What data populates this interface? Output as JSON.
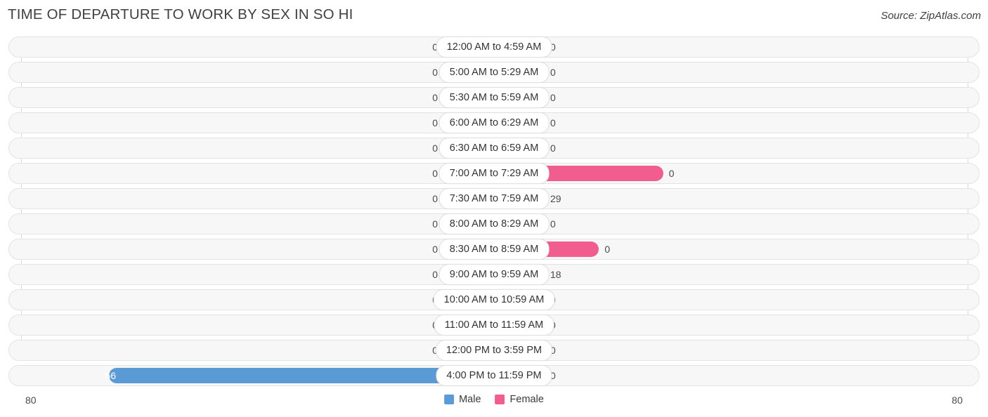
{
  "header": {
    "title": "TIME OF DEPARTURE TO WORK BY SEX IN SO HI",
    "source": "Source: ZipAtlas.com"
  },
  "axis": {
    "left_max_label": "80",
    "right_max_label": "80"
  },
  "legend": {
    "items": [
      {
        "label": "Male",
        "color": "#5b9bd5"
      },
      {
        "label": "Female",
        "color": "#f05d8e"
      }
    ]
  },
  "chart_data": {
    "type": "bar",
    "title": "TIME OF DEPARTURE TO WORK BY SEX IN SO HI",
    "subtitle": "Source: ZipAtlas.com",
    "orientation": "horizontal-diverging",
    "xlabel": "",
    "ylabel": "",
    "xlim": [
      -80,
      80
    ],
    "axis_max": 80,
    "grid": false,
    "legend_position": "bottom-center",
    "categories": [
      "12:00 AM to 4:59 AM",
      "5:00 AM to 5:29 AM",
      "5:30 AM to 5:59 AM",
      "6:00 AM to 6:29 AM",
      "6:30 AM to 6:59 AM",
      "7:00 AM to 7:29 AM",
      "7:30 AM to 7:59 AM",
      "8:00 AM to 8:29 AM",
      "8:30 AM to 8:59 AM",
      "9:00 AM to 9:59 AM",
      "10:00 AM to 10:59 AM",
      "11:00 AM to 11:59 AM",
      "12:00 PM to 3:59 PM",
      "4:00 PM to 11:59 PM"
    ],
    "series": [
      {
        "name": "Male",
        "color": "#5b9bd5",
        "values": [
          0,
          0,
          0,
          0,
          0,
          0,
          0,
          0,
          0,
          0,
          0,
          0,
          0,
          66
        ]
      },
      {
        "name": "Female",
        "color": "#f05d8e",
        "values": [
          0,
          0,
          0,
          0,
          0,
          29,
          0,
          0,
          18,
          0,
          0,
          0,
          0,
          0
        ]
      }
    ]
  },
  "rows": [
    {
      "label": "12:00 AM to 4:59 AM",
      "male": "0",
      "female": "0"
    },
    {
      "label": "5:00 AM to 5:29 AM",
      "male": "0",
      "female": "0"
    },
    {
      "label": "5:30 AM to 5:59 AM",
      "male": "0",
      "female": "0"
    },
    {
      "label": "6:00 AM to 6:29 AM",
      "male": "0",
      "female": "0"
    },
    {
      "label": "6:30 AM to 6:59 AM",
      "male": "0",
      "female": "0"
    },
    {
      "label": "7:00 AM to 7:29 AM",
      "male": "0",
      "female": "0"
    },
    {
      "label": "7:30 AM to 7:59 AM",
      "male": "0",
      "female": "29"
    },
    {
      "label": "8:00 AM to 8:29 AM",
      "male": "0",
      "female": "0"
    },
    {
      "label": "8:30 AM to 8:59 AM",
      "male": "0",
      "female": "0"
    },
    {
      "label": "9:00 AM to 9:59 AM",
      "male": "0",
      "female": "18"
    },
    {
      "label": "10:00 AM to 10:59 AM",
      "male": "0",
      "female": "0"
    },
    {
      "label": "11:00 AM to 11:59 AM",
      "male": "0",
      "female": "0"
    },
    {
      "label": "12:00 PM to 3:59 PM",
      "male": "0",
      "female": "0"
    },
    {
      "label": "4:00 PM to 11:59 PM",
      "male": "66",
      "female": "0"
    }
  ]
}
